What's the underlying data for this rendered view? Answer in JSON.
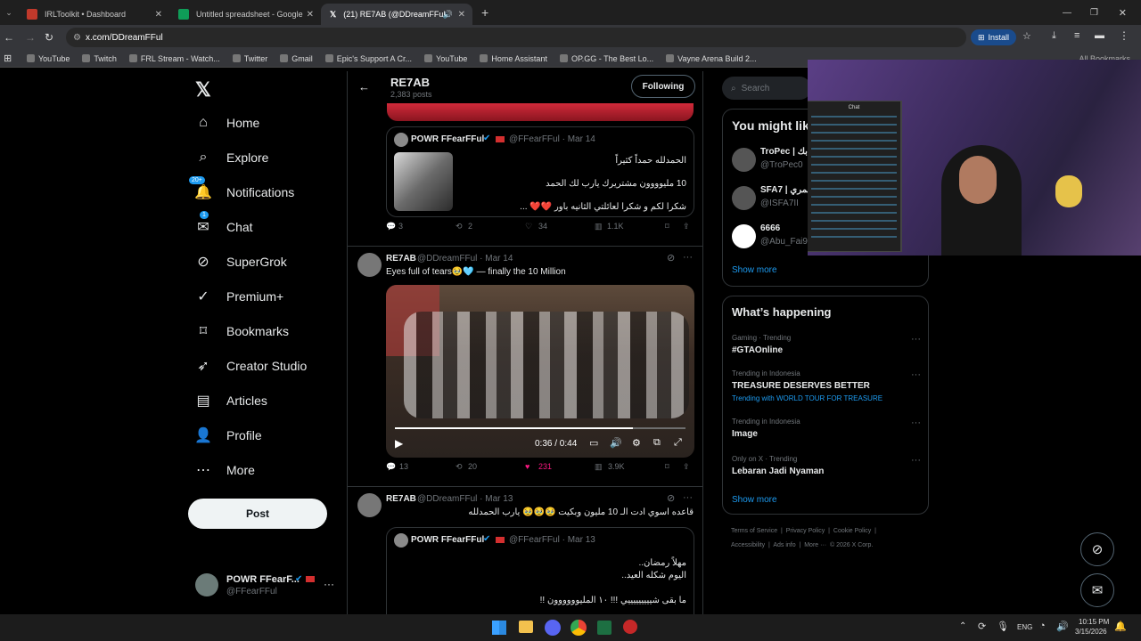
{
  "tabs": [
    {
      "title": "IRLToolkit • Dashboard",
      "color": "#c0392b"
    },
    {
      "title": "Untitled spreadsheet - Google",
      "color": "#0f9d58"
    },
    {
      "title": "(21) RE7AB (@DDreamFFul",
      "color": "#000000"
    }
  ],
  "address": {
    "url": "x.com/DDreamFFul",
    "install": "Install"
  },
  "bookmarks": [
    "YouTube",
    "Twitch",
    "FRL Stream - Watch...",
    "Twitter",
    "Gmail",
    "Epic's Support A Cr...",
    "YouTube",
    "Home Assistant",
    "OP.GG - The Best Lo...",
    "Vayne Arena Build 2..."
  ],
  "all_bookmarks": "All Bookmarks",
  "nav": {
    "items": [
      {
        "label": "Home",
        "icon": "home-icon"
      },
      {
        "label": "Explore",
        "icon": "search-icon"
      },
      {
        "label": "Notifications",
        "icon": "bell-icon",
        "badge": "20+"
      },
      {
        "label": "Chat",
        "icon": "mail-icon",
        "badge": "1"
      },
      {
        "label": "SuperGrok",
        "icon": "grok-icon"
      },
      {
        "label": "Premium+",
        "icon": "verified-icon"
      },
      {
        "label": "Bookmarks",
        "icon": "bookmark-icon"
      },
      {
        "label": "Creator Studio",
        "icon": "rocket-icon"
      },
      {
        "label": "Articles",
        "icon": "article-icon"
      },
      {
        "label": "Profile",
        "icon": "person-icon"
      },
      {
        "label": "More",
        "icon": "more-circle-icon"
      }
    ],
    "post": "Post",
    "account": {
      "name": "POWR FFearF...",
      "handle": "@FFearFFul"
    }
  },
  "header": {
    "name": "RE7AB",
    "posts": "2,383 posts",
    "following": "Following"
  },
  "tweets": {
    "quote1": {
      "name": "POWR FFearFFul",
      "handle": "@FFearFFul · Mar 14",
      "lines": [
        "الحمدلله حمداً كثيراً",
        "10 مليوووون مشتريرك يارب لك الحمد",
        "شكرا لكم و شكرا لعائلتي الثانيه باور ❤️❤️ ..."
      ],
      "replies": "3",
      "reposts": "2",
      "likes": "34",
      "views": "1.1K"
    },
    "tweet2": {
      "name": "RE7AB",
      "handle": "@DDreamFFul · Mar 14",
      "text": "Eyes full of tears🥹🩵 — finally the 10 Million",
      "time": "0:36 / 0:44",
      "replies": "13",
      "reposts": "20",
      "likes": "231",
      "views": "3.9K"
    },
    "tweet3": {
      "name": "RE7AB",
      "handle": "@DDreamFFul · Mar 13",
      "text": "قاعده اسوي ادت الـ 10 مليون وبكيت 🥹🥹🥹 يارب الحمدلله"
    },
    "quote3": {
      "name": "POWR FFearFFul",
      "handle": "@FFearFFul · Mar 13",
      "lines": [
        "مهلاً رمضان..",
        "اليوم شكله العيد..",
        "ما بقى شيييييييييي !!! ١٠ المليوووووون !!"
      ]
    }
  },
  "right": {
    "search": "Search",
    "wtf_title": "You might lik",
    "wtf": [
      {
        "name": "TroPec | بك",
        "handle": "@TroPec0"
      },
      {
        "name": "SFA7 | شمري",
        "handle": "@ISFA7II"
      },
      {
        "name": "6666",
        "handle": "@Abu_Fai9a"
      }
    ],
    "show_more": "Show more",
    "happening_title": "What’s happening",
    "trends": [
      {
        "context": "Gaming · Trending",
        "topic": "#GTAOnline",
        "extra": ""
      },
      {
        "context": "Trending in Indonesia",
        "topic": "TREASURE DESERVES BETTER",
        "extra": "Trending with WORLD TOUR FOR TREASURE"
      },
      {
        "context": "Trending in Indonesia",
        "topic": "Image",
        "extra": ""
      },
      {
        "context": "Only on X · Trending",
        "topic": "Lebaran Jadi Nyaman",
        "extra": ""
      }
    ],
    "show_more2": "Show more",
    "footer1": "Terms of Service  |  Privacy Policy  |  Cookie Policy  |",
    "footer2": "Accessibility  |  Ads info  |  More ···  © 2026 X Corp."
  },
  "stream_chat_title": "Chat",
  "taskbar": {
    "lang": "ENG",
    "time": "10:15 PM",
    "date": "3/15/2026"
  },
  "colors": {
    "accent": "#1d9bf0",
    "like": "#f91880",
    "bg": "#000000"
  }
}
